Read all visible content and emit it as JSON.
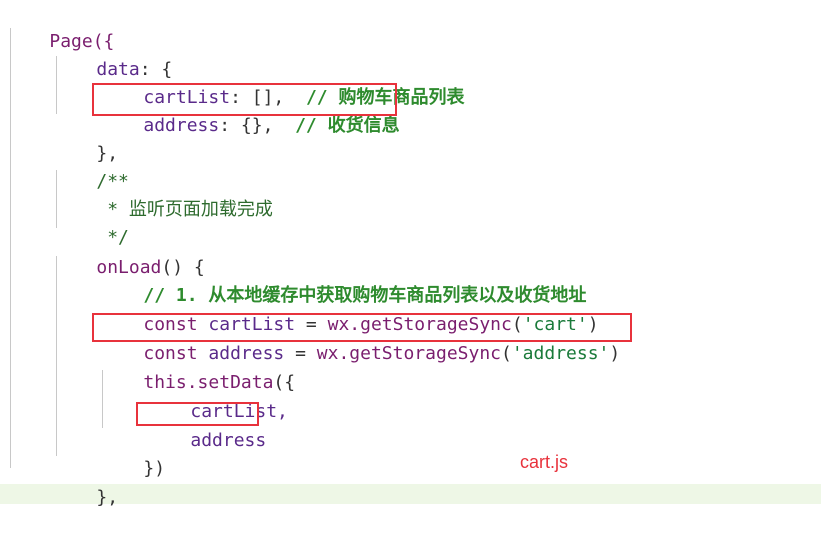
{
  "code": {
    "page_open": "Page({",
    "data_key": "data",
    "data_colon": ": {",
    "cartlist_key": "cartList",
    "cartlist_val": ": [],",
    "cartlist_comment": "// 购物车商品列表",
    "address_key": "address",
    "address_val": ": {},",
    "address_comment": "// 收货信息",
    "data_close": "},",
    "doc_open": "/**",
    "doc_body": " * 监听页面加载完成",
    "doc_close": " */",
    "onload_name": "onLoad",
    "onload_sig": "() {",
    "step_comment": "// 1. 从本地缓存中获取购物车商品列表以及收货地址",
    "const1_kw": "const",
    "const1_var": "cartList",
    "const1_eq": " = ",
    "const1_obj": "wx.",
    "const1_fn": "getStorageSync",
    "const1_arg_open": "(",
    "const1_arg": "'cart'",
    "const1_arg_close": ")",
    "const2_kw": "const",
    "const2_var": "address",
    "const2_eq": " = ",
    "const2_obj": "wx.",
    "const2_fn": "getStorageSync",
    "const2_arg_open": "(",
    "const2_arg": "'address'",
    "const2_arg_close": ")",
    "this_kw": "this",
    "setdata_fn": ".setData",
    "setdata_open": "({",
    "arg_cartlist": "cartList,",
    "arg_address": "address",
    "setdata_close": "})",
    "onload_close": "},"
  },
  "caption": "cart.js",
  "colors": {
    "highlight_box": "#e8323c",
    "caption": "#e8323c",
    "comment": "#2e8b2e",
    "keyword": "#7a1e6e",
    "string": "#1a7a3a"
  }
}
